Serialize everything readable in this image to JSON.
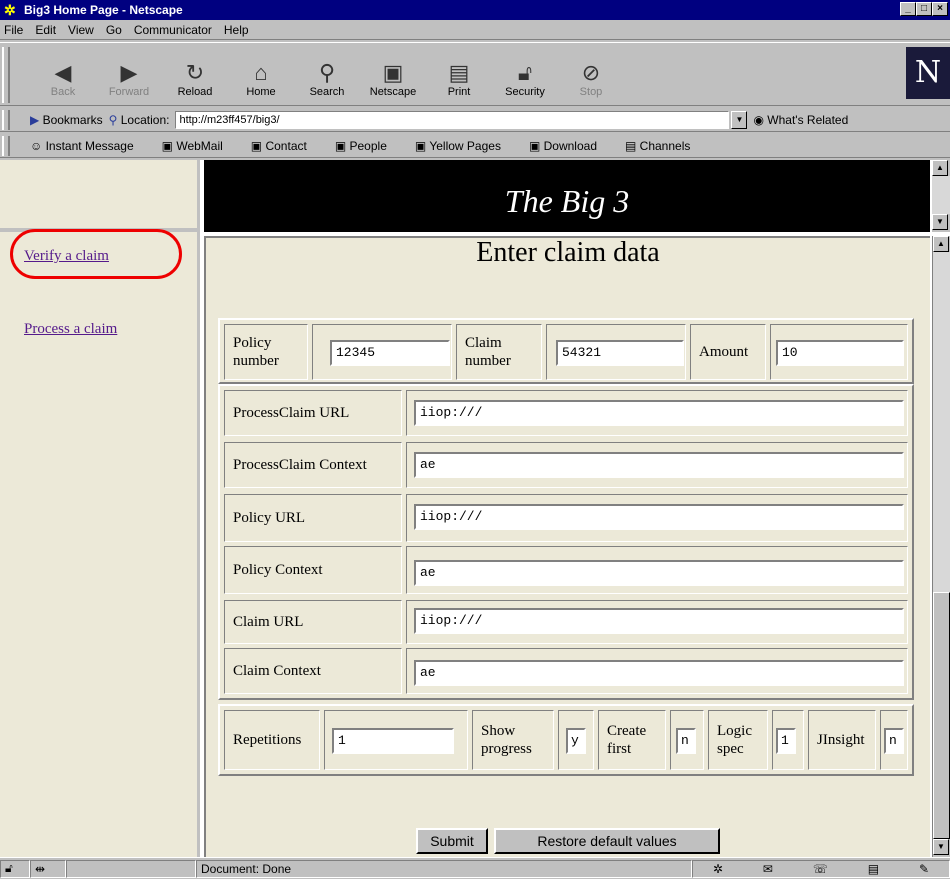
{
  "window": {
    "title": "Big3 Home Page - Netscape"
  },
  "menu": [
    "File",
    "Edit",
    "View",
    "Go",
    "Communicator",
    "Help"
  ],
  "toolbar": [
    {
      "label": "Back",
      "icon": "back-arrow-icon",
      "enabled": false
    },
    {
      "label": "Forward",
      "icon": "forward-arrow-icon",
      "enabled": false
    },
    {
      "label": "Reload",
      "icon": "reload-icon",
      "enabled": true
    },
    {
      "label": "Home",
      "icon": "home-icon",
      "enabled": true
    },
    {
      "label": "Search",
      "icon": "search-icon",
      "enabled": true
    },
    {
      "label": "Netscape",
      "icon": "netscape-icon",
      "enabled": true
    },
    {
      "label": "Print",
      "icon": "print-icon",
      "enabled": true
    },
    {
      "label": "Security",
      "icon": "lock-icon",
      "enabled": true
    },
    {
      "label": "Stop",
      "icon": "stop-icon",
      "enabled": false
    }
  ],
  "location": {
    "bookmarks_label": "Bookmarks",
    "location_label": "Location:",
    "url": "http://m23ff457/big3/",
    "related_label": "What's Related"
  },
  "personal": [
    "Instant Message",
    "WebMail",
    "Contact",
    "People",
    "Yellow Pages",
    "Download",
    "Channels"
  ],
  "banner": {
    "title": "The Big 3"
  },
  "nav": {
    "verify": "Verify a claim",
    "process": "Process a claim"
  },
  "form": {
    "heading": "Enter claim data",
    "policy_number_label": "Policy number",
    "policy_number": "12345",
    "claim_number_label": "Claim number",
    "claim_number": "54321",
    "amount_label": "Amount",
    "amount": "10",
    "urls": [
      {
        "label": "ProcessClaim URL",
        "value": "iiop:///"
      },
      {
        "label": "ProcessClaim Context",
        "value": "ae"
      },
      {
        "label": "Policy URL",
        "value": "iiop:///"
      },
      {
        "label": "Policy Context",
        "value": "ae"
      },
      {
        "label": "Claim URL",
        "value": "iiop:///"
      },
      {
        "label": "Claim Context",
        "value": "ae"
      }
    ],
    "repetitions_label": "Repetitions",
    "repetitions": "1",
    "show_progress_label": "Show progress",
    "show_progress": "y",
    "create_first_label": "Create first",
    "create_first": "n",
    "logic_spec_label": "Logic spec",
    "logic_spec": "1",
    "jinsight_label": "JInsight",
    "jinsight": "n",
    "submit_label": "Submit",
    "restore_label": "Restore default values"
  },
  "status": {
    "text": "Document: Done"
  },
  "colors": {
    "titlebar": "#000080",
    "link": "#551a8b",
    "highlight": "#e00000",
    "banner_bg": "#000000",
    "page_bg": "#ece9d8"
  }
}
